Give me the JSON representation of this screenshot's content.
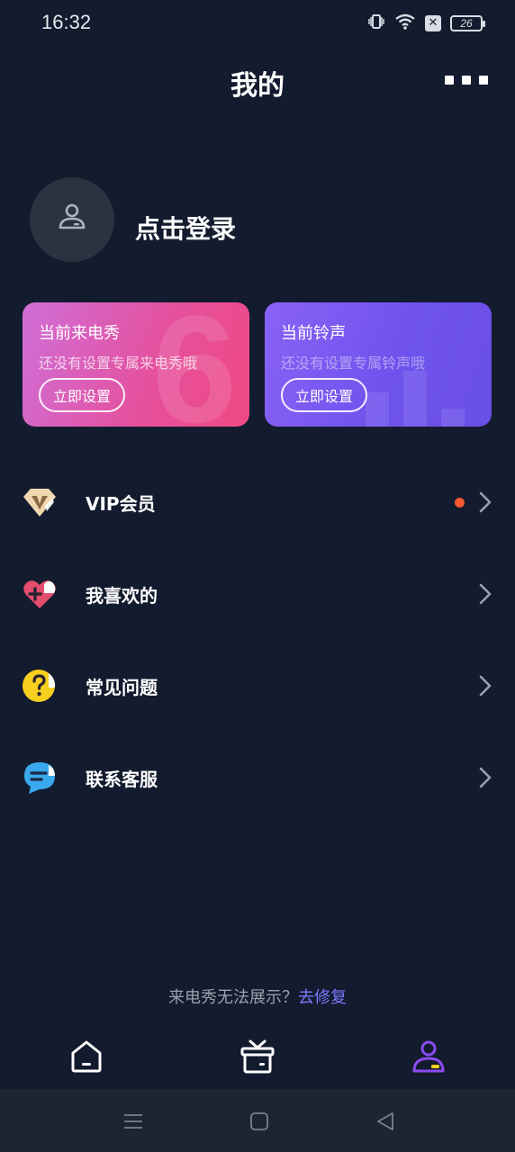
{
  "status_bar": {
    "time": "16:32",
    "battery": "26",
    "icons": [
      "vibrate-icon",
      "wifi-icon",
      "no-sim-icon",
      "battery-icon"
    ]
  },
  "header": {
    "title": "我的",
    "more_icon": "more-icon"
  },
  "profile": {
    "login_text": "点击登录",
    "avatar_icon": "user-icon"
  },
  "cards": {
    "caller_show": {
      "title": "当前来电秀",
      "subtitle": "还没有设置专属来电秀哦",
      "button": "立即设置"
    },
    "ringtone": {
      "title": "当前铃声",
      "subtitle": "还没有设置专属铃声哦",
      "button": "立即设置"
    }
  },
  "menu": {
    "items": [
      {
        "label": "VIP会员",
        "icon": "vip-diamond-icon",
        "has_badge": true
      },
      {
        "label": "我喜欢的",
        "icon": "heart-plus-icon",
        "has_badge": false
      },
      {
        "label": "常见问题",
        "icon": "question-icon",
        "has_badge": false
      },
      {
        "label": "联系客服",
        "icon": "chat-bubble-icon",
        "has_badge": false
      }
    ]
  },
  "footer": {
    "repair_text": "来电秀无法展示？",
    "repair_link": "去修复"
  },
  "bottom_nav": {
    "items": [
      {
        "icon": "home-icon",
        "active": false
      },
      {
        "icon": "gift-icon",
        "active": false
      },
      {
        "icon": "profile-icon",
        "active": true
      }
    ]
  },
  "colors": {
    "background": "#131b2e",
    "accent": "#8c4bf0",
    "link": "#7d7aff",
    "badge": "#f0592e"
  }
}
